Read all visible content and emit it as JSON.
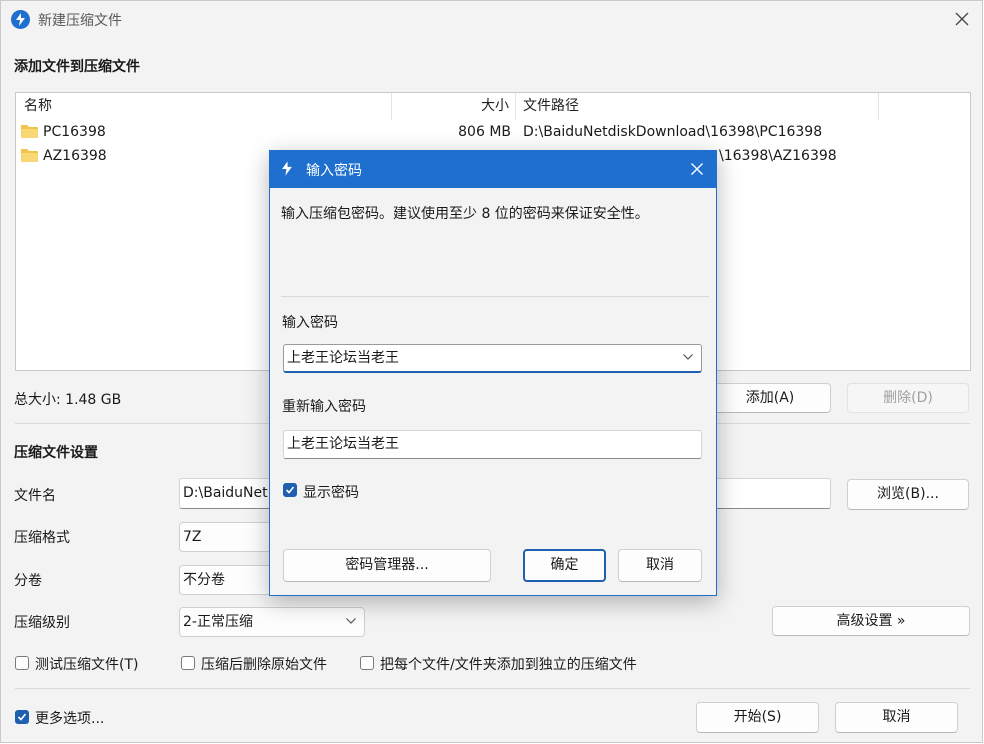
{
  "window": {
    "title": "新建压缩文件"
  },
  "add_section": {
    "heading": "添加文件到压缩文件",
    "columns": {
      "name": "名称",
      "size": "大小",
      "path": "文件路径"
    },
    "rows": [
      {
        "name": "PC16398",
        "size": "806 MB",
        "path": "D:\\BaiduNetdiskDownload\\16398\\PC16398"
      },
      {
        "name": "AZ16398",
        "size": "",
        "path": "\\16398\\AZ16398"
      }
    ],
    "total_size": "总大小: 1.48 GB",
    "add_button": "添加(A)",
    "remove_button": "删除(D)"
  },
  "settings": {
    "heading": "压缩文件设置",
    "filename_label": "文件名",
    "filename_value": "D:\\BaiduNet",
    "browse_button": "浏览(B)...",
    "format_label": "压缩格式",
    "format_value": "7Z",
    "split_label": "分卷",
    "split_value": "不分卷",
    "level_label": "压缩级别",
    "level_value": "2-正常压缩",
    "advanced_button": "高级设置 »",
    "test_check": "测试压缩文件(T)",
    "delete_check": "压缩后删除原始文件",
    "each_check": "把每个文件/文件夹添加到独立的压缩文件"
  },
  "footer": {
    "more_options": "更多选项...",
    "start_button": "开始(S)",
    "cancel_button": "取消"
  },
  "dialog": {
    "title": "输入密码",
    "description": "输入压缩包密码。建议使用至少 8 位的密码来保证安全性。",
    "password_label": "输入密码",
    "password_value": "上老王论坛当老王",
    "confirm_label": "重新输入密码",
    "confirm_value": "上老王论坛当老王",
    "show_password": "显示密码",
    "manager_button": "密码管理器...",
    "ok_button": "确定",
    "cancel_button": "取消"
  },
  "colors": {
    "accent": "#1f6fcf",
    "folder": "#f3c24d"
  }
}
